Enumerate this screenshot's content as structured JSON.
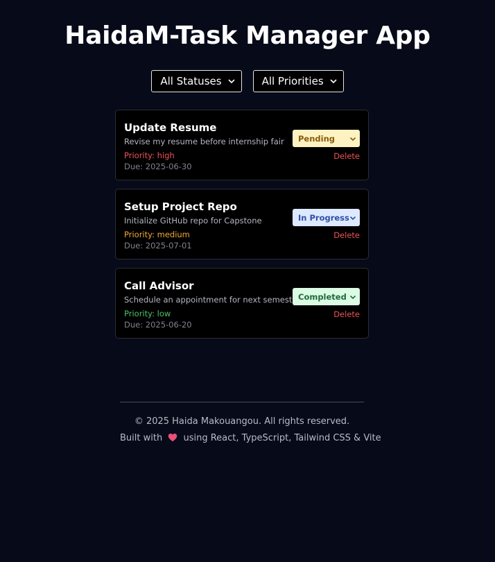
{
  "app": {
    "title": "HaidaM-Task Manager App"
  },
  "filters": {
    "status": {
      "selected": "All Statuses"
    },
    "priority": {
      "selected": "All Priorities"
    }
  },
  "tasks": [
    {
      "title": "Update Resume",
      "description": "Revise my resume before internship fair",
      "priority_text": "Priority: high",
      "priority_color": "#f0515a",
      "due_text": "Due: 2025-06-30",
      "status": "Pending",
      "status_bg": "#fdf3c2",
      "status_color": "#8a5a0a",
      "delete_label": "Delete"
    },
    {
      "title": "Setup Project Repo",
      "description": "Initialize GitHub repo for Capstone",
      "priority_text": "Priority: medium",
      "priority_color": "#f0a93a",
      "due_text": "Due: 2025-07-01",
      "status": "In Progress",
      "status_bg": "#dde9ff",
      "status_color": "#2f4fa8",
      "delete_label": "Delete"
    },
    {
      "title": "Call Advisor",
      "description": "Schedule an appointment for next semester",
      "priority_text": "Priority: low",
      "priority_color": "#4ec26a",
      "due_text": "Due: 2025-06-20",
      "status": "Completed",
      "status_bg": "#dcfbe4",
      "status_color": "#1f6b3a",
      "delete_label": "Delete"
    }
  ],
  "footer": {
    "copyright": "© 2025 Haida Makouangou. All rights reserved.",
    "built_prefix": "Built with",
    "built_suffix": "using React, TypeScript, Tailwind CSS & Vite",
    "heart_icon": "heart-icon",
    "heart_color": "#e8507a"
  }
}
